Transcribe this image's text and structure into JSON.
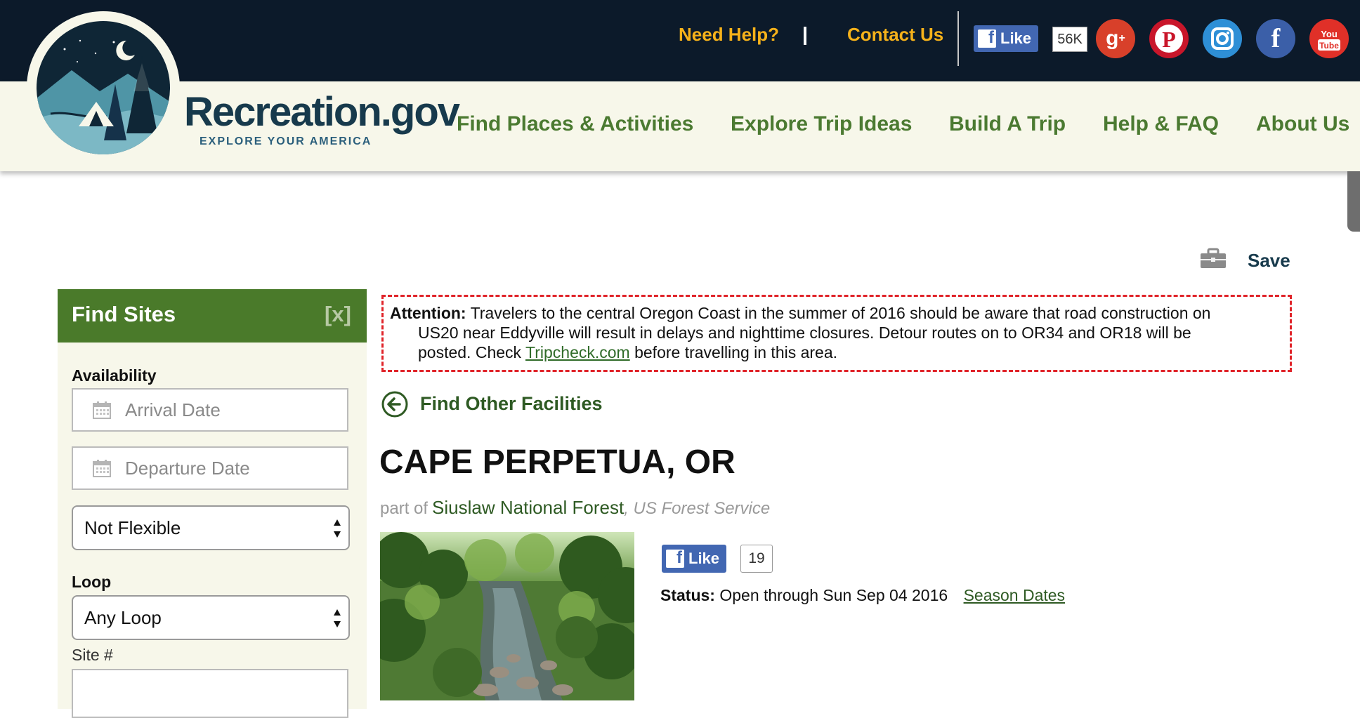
{
  "header": {
    "need_help": "Need Help?",
    "separator": "|",
    "contact_us": "Contact Us",
    "fb_like": "Like",
    "fb_count": "56K"
  },
  "brand": {
    "name": "Recreation.gov",
    "tagline": "EXPLORE YOUR AMERICA"
  },
  "social_icons": [
    "google-plus-icon",
    "pinterest-icon",
    "instagram-icon",
    "facebook-icon",
    "youtube-icon"
  ],
  "nav": {
    "items": [
      {
        "label": "Find Places & Activities"
      },
      {
        "label": "Explore Trip Ideas"
      },
      {
        "label": "Build A Trip"
      },
      {
        "label": "Help & FAQ"
      },
      {
        "label": "About Us"
      }
    ]
  },
  "save": {
    "label": "Save"
  },
  "sidebar": {
    "title": "Find Sites",
    "close": "[x]",
    "availability_label": "Availability",
    "arrival_placeholder": "Arrival Date",
    "departure_placeholder": "Departure Date",
    "flex_value": "Not Flexible",
    "loop_label": "Loop",
    "loop_value": "Any Loop",
    "site_label": "Site #"
  },
  "attention": {
    "prefix": "Attention:",
    "line1": "Travelers to the central Oregon Coast in the summer of 2016 should be aware that road construction on",
    "line2": "US20 near Eddyville will result in delays and nighttime closures. Detour routes on to OR34 and OR18 will be",
    "line3_before": "posted. Check",
    "link": "Tripcheck.com",
    "line3_after": "before travelling in this area."
  },
  "back_link": "Find Other Facilities",
  "facility": {
    "title": "CAPE PERPETUA, OR",
    "part_of": "part of",
    "forest": "Siuslaw National Forest",
    "agency": ", US Forest Service",
    "like_label": "Like",
    "like_count": "19",
    "status_label": "Status:",
    "status_value": "Open through Sun Sep 04 2016",
    "season_dates": "Season Dates"
  },
  "colors": {
    "top_bar": "#0c1a2a",
    "nav_bg": "#f7f7ea",
    "nav_text": "#4b7a31",
    "accent_yellow": "#f6b21a",
    "sidebar_head": "#4a7a2a",
    "attention_border": "#e0242a"
  }
}
